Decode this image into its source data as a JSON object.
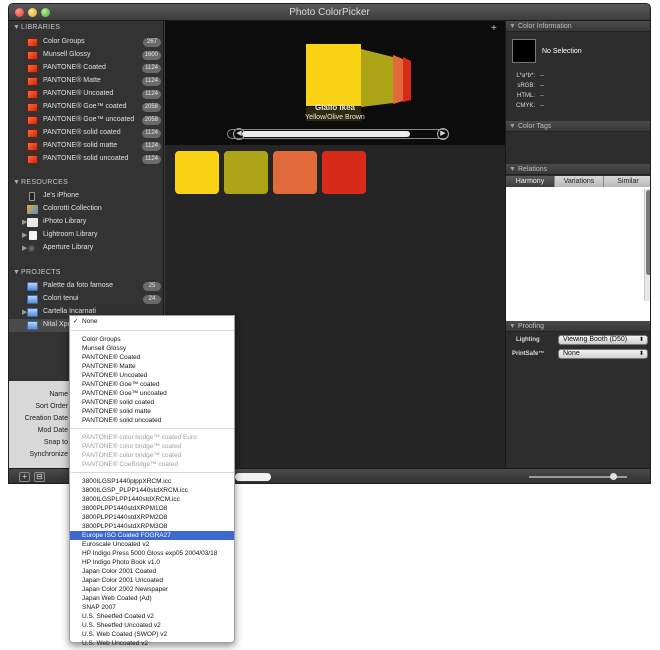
{
  "window": {
    "title": "Photo ColorPicker"
  },
  "sidebar": {
    "libraries_header": "LIBRARIES",
    "libraries": [
      {
        "label": "Color Groups",
        "count": "267"
      },
      {
        "label": "Munsell Glossy",
        "count": "1600"
      },
      {
        "label": "PANTONE® Coated",
        "count": "1124"
      },
      {
        "label": "PANTONE® Matte",
        "count": "1124"
      },
      {
        "label": "PANTONE® Uncoated",
        "count": "1124"
      },
      {
        "label": "PANTONE® Goe™ coated",
        "count": "2058"
      },
      {
        "label": "PANTONE® Goe™ uncoated",
        "count": "2058"
      },
      {
        "label": "PANTONE® solid coated",
        "count": "1124"
      },
      {
        "label": "PANTONE® solid matte",
        "count": "1124"
      },
      {
        "label": "PANTONE® solid uncoated",
        "count": "1124"
      }
    ],
    "resources_header": "RESOURCES",
    "resources": [
      {
        "label": "Je's iPhone"
      },
      {
        "label": "Colorotti Collection"
      },
      {
        "label": "iPhoto Library"
      },
      {
        "label": "Lightroom Library"
      },
      {
        "label": "Aperture Library"
      }
    ],
    "projects_header": "PROJECTS",
    "projects": [
      {
        "label": "Palette da foto famose",
        "count": "25"
      },
      {
        "label": "Colori tenui",
        "count": "24"
      },
      {
        "label": "Cartella Incarnati",
        "count": ""
      },
      {
        "label": "Nital Xpe",
        "count": ""
      }
    ]
  },
  "info_panel": {
    "labels": [
      "Name",
      "Sort Order",
      "Creation Date",
      "Mod Date",
      "Snap to",
      "Synchronize"
    ]
  },
  "stage": {
    "color_name": "Giallo Ikea",
    "color_family": "Yellow/Olive Brown",
    "prev_label": "◀",
    "next_label": "▶"
  },
  "swatches": [
    {
      "color": "#f8d313"
    },
    {
      "color": "#aea418"
    },
    {
      "color": "#e06a3a"
    },
    {
      "color": "#d82a18"
    }
  ],
  "right_panel": {
    "color_info_header": "Color Information",
    "no_selection": "No Selection",
    "info_rows": [
      {
        "label": "L*a*b*:",
        "value": "--"
      },
      {
        "label": "sRGB:",
        "value": "--"
      },
      {
        "label": "HTML:",
        "value": "--"
      },
      {
        "label": "CMYK:",
        "value": "--"
      }
    ],
    "color_tags_header": "Color Tags",
    "relations_header": "Relations",
    "tabs": [
      "Harmony",
      "Variations",
      "Similar"
    ],
    "proofing_header": "Proofing",
    "lighting_label": "Lighting",
    "lighting_value": "Viewing Booth (D50)",
    "printsafe_label": "PrintSafe™",
    "printsafe_value": "None"
  },
  "menu": {
    "checked_item": "None",
    "group1": [
      "Color Groups",
      "Munsell Glossy",
      "PANTONE® Coated",
      "PANTONE® Matte",
      "PANTONE® Uncoated",
      "PANTONE® Goe™ coated",
      "PANTONE® Goe™ uncoated",
      "PANTONE® solid coated",
      "PANTONE® solid matte",
      "PANTONE® solid uncoated"
    ],
    "group2_disabled": [
      "PANTONE® color bridge™ coated Euro",
      "PANTONE® color bridge™ coated",
      "PANTONE® color bridge™ coated",
      "PANTONE® CoeBridge™ coated"
    ],
    "group3": [
      "3800ILGSP1440plppXRCM.icc",
      "3800ILGSP_PLPP1440stdXRCM.icc",
      "3800ILGSPLPP1440stdXRCM.icc",
      "3800PLPP1440stdXRPM1O8",
      "3800PLPP1440stdXRPM2O8",
      "3800PLPP1440stdXRPM3O8",
      "Europe ISO Coated FOGRA27",
      "Euroscale Uncoated v2",
      "HP Indigo Press 5000 Gloss exp05 2004/03/18",
      "HP Indigo Photo Book v1.0",
      "Japan Color 2001 Coated",
      "Japan Color 2001 Uncoated",
      "Japan Color 2002 Newspaper",
      "Japan Web Coated (Ad)",
      "SNAP 2007",
      "U.S. Sheetfed Coated v2",
      "U.S. Sheetfed Uncoated v2",
      "U.S. Web Coated (SWOP) v2",
      "U.S. Web Uncoated v2"
    ],
    "highlighted": "Europe ISO Coated FOGRA27"
  },
  "bottom": {
    "add_label": "+",
    "action_label": "⊟"
  }
}
